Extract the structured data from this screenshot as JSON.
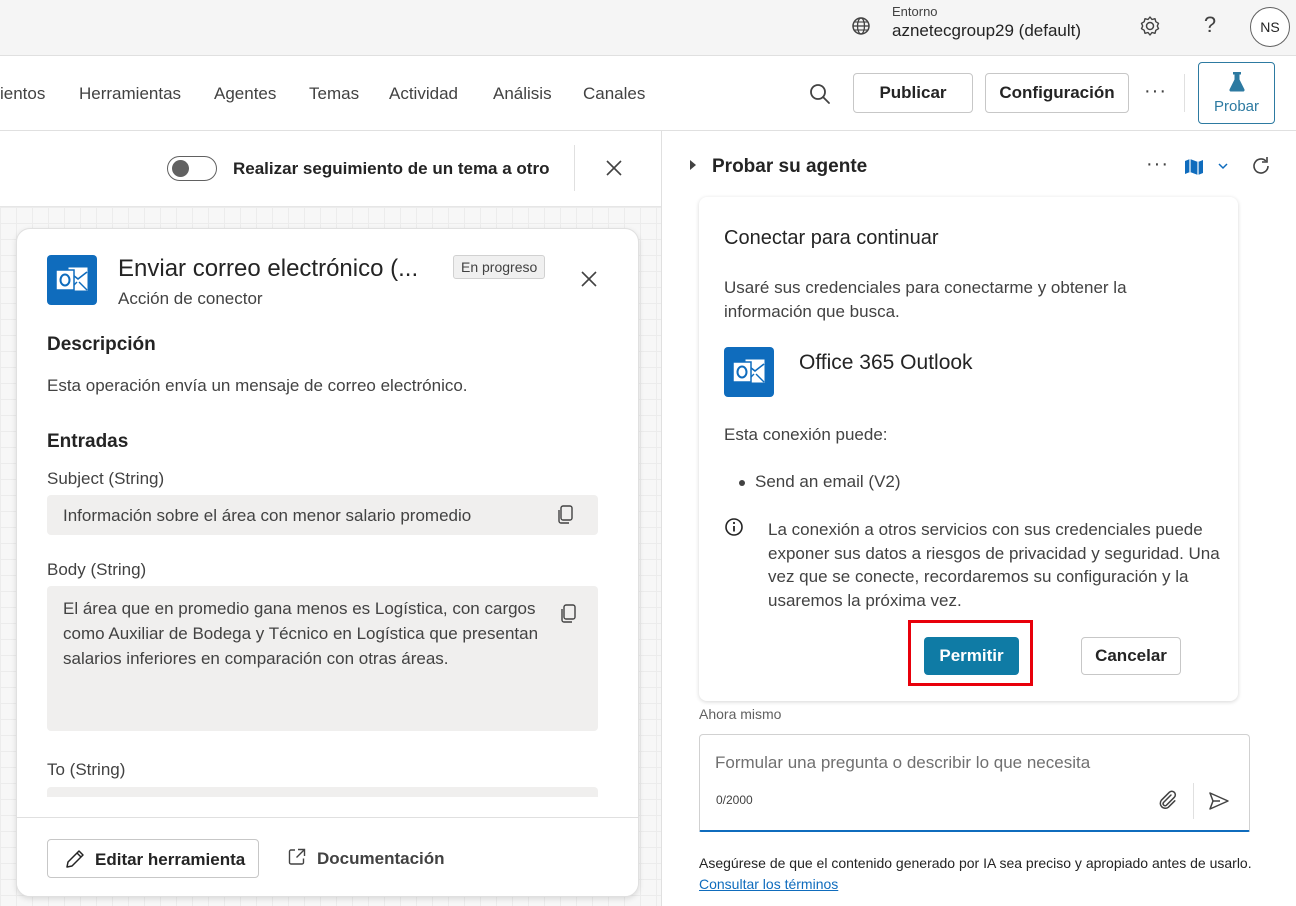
{
  "topbar": {
    "env_label": "Entorno",
    "env_value": "aznetecgroup29 (default)",
    "avatar_initials": "NS",
    "help_glyph": "?"
  },
  "nav": {
    "tabs": [
      "ientos",
      "Herramientas",
      "Agentes",
      "Temas",
      "Actividad",
      "Análisis",
      "Canales"
    ],
    "publish_label": "Publicar",
    "config_label": "Configuración",
    "more_glyph": "···",
    "test_label": "Probar"
  },
  "left_panel": {
    "toggle_label": "Realizar seguimiento de un tema a otro"
  },
  "tool_card": {
    "title": "Enviar correo electrónico (...",
    "badge": "En progreso",
    "subtitle": "Acción de conector",
    "description_heading": "Descripción",
    "description_text": "Esta operación envía un mensaje de correo electrónico.",
    "inputs_heading": "Entradas",
    "fields": [
      {
        "label": "Subject (String)",
        "value": "Información sobre el área con menor salario promedio"
      },
      {
        "label": "Body (String)",
        "value": "El área que en promedio gana menos es Logística, con cargos como Auxiliar de Bodega y Técnico en Logística que presentan salarios inferiores en comparación con otras áreas."
      },
      {
        "label": "To (String)",
        "value": ""
      }
    ],
    "edit_button": "Editar herramienta",
    "docs_button": "Documentación"
  },
  "test_pane": {
    "title": "Probar su agente",
    "more_glyph": "···",
    "connect_card": {
      "title": "Conectar para continuar",
      "description": "Usaré sus credenciales para conectarme y obtener la información que busca.",
      "connector_name": "Office 365 Outlook",
      "can_label": "Esta conexión puede:",
      "capabilities": [
        "Send an email (V2)"
      ],
      "warning": "La conexión a otros servicios con sus credenciales puede exponer sus datos a riesgos de privacidad y seguridad. Una vez que se conecte, recordaremos su configuración y la usaremos la próxima vez.",
      "allow_label": "Permitir",
      "cancel_label": "Cancelar"
    },
    "timestamp": "Ahora mismo",
    "input_placeholder": "Formular una pregunta o describir lo que necesita",
    "char_count": "0/2000",
    "disclaimer_text": "Asegúrese de que el contenido generado por IA sea preciso y apropiado antes de usarlo.",
    "disclaimer_link": "Consultar los términos"
  },
  "colors": {
    "accent": "#0f7ba5",
    "outlook_blue": "#0f6cbd",
    "highlight_red": "#e8000b"
  },
  "icons": [
    "globe-icon",
    "gear-icon",
    "help-icon",
    "search-icon",
    "flask-icon",
    "close-icon",
    "outlook-icon",
    "copy-icon",
    "pencil-icon",
    "open-external-icon",
    "map-icon",
    "chevron-down-icon",
    "refresh-icon",
    "info-icon",
    "attach-icon",
    "send-icon"
  ]
}
